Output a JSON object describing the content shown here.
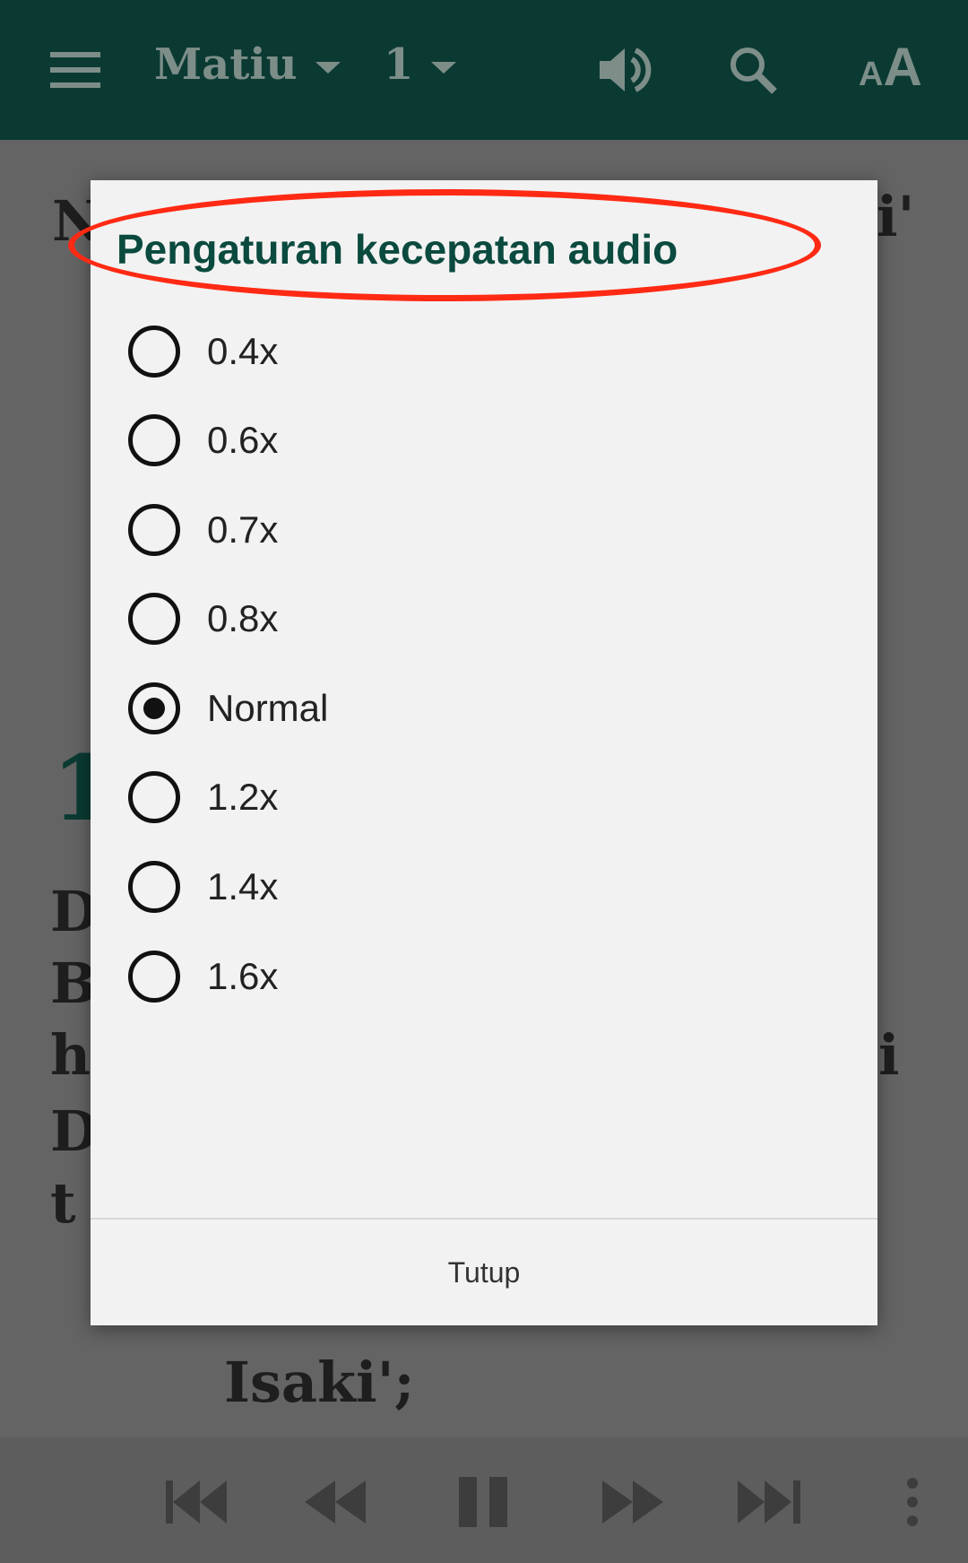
{
  "topbar": {
    "book": "Matiu",
    "chapter": "1",
    "icons": [
      "menu-icon",
      "volume-icon",
      "search-icon",
      "text-size-icon"
    ],
    "text_size_label": "AA",
    "color": "#0b3a33"
  },
  "background_text": {
    "line1_left": "N",
    "line1_right": "i'",
    "heading": "1",
    "lines": [
      "D",
      "B",
      "h",
      "D",
      "t"
    ],
    "right_h": "i",
    "last_line": "Isaki';"
  },
  "dialog": {
    "title": "Pengaturan kecepatan audio",
    "title_color": "#0b4a3e",
    "highlight_color": "#ff2a14",
    "options": [
      {
        "label": "0.4x",
        "selected": false
      },
      {
        "label": "0.6x",
        "selected": false
      },
      {
        "label": "0.7x",
        "selected": false
      },
      {
        "label": "0.8x",
        "selected": false
      },
      {
        "label": "Normal",
        "selected": true
      },
      {
        "label": "1.2x",
        "selected": false
      },
      {
        "label": "1.4x",
        "selected": false
      },
      {
        "label": "1.6x",
        "selected": false
      }
    ],
    "close_label": "Tutup"
  },
  "bottombar": {
    "icons": [
      "skip-previous-icon",
      "rewind-icon",
      "pause-icon",
      "fast-forward-icon",
      "skip-next-icon",
      "more-vert-icon"
    ]
  }
}
